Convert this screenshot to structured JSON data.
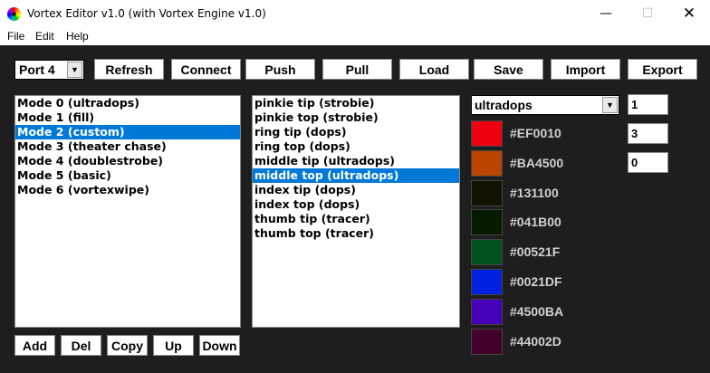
{
  "window": {
    "title": "Vortex Editor v1.0 (with Vortex Engine v1.0)",
    "controls": [
      "—",
      "☐",
      "✕"
    ]
  },
  "menu": [
    "File",
    "Edit",
    "Help"
  ],
  "port": {
    "selected": "Port 4"
  },
  "toolbar": [
    "Refresh",
    "Connect",
    "Push",
    "Pull",
    "Load",
    "Save",
    "Import",
    "Export"
  ],
  "modes": {
    "items": [
      "Mode 0 (ultradops)",
      "Mode 1 (fill)",
      "Mode 2 (custom)",
      "Mode 3 (theater chase)",
      "Mode 4 (doublestrobe)",
      "Mode 5 (basic)",
      "Mode 6 (vortexwipe)"
    ],
    "selected_index": 2
  },
  "leds": {
    "items": [
      "pinkie tip (strobie)",
      "pinkie top (strobie)",
      "ring tip (dops)",
      "ring top (dops)",
      "middle tip (ultradops)",
      "middle top (ultradops)",
      "index tip (dops)",
      "index top (dops)",
      "thumb tip (tracer)",
      "thumb top (tracer)"
    ],
    "selected_index": 5
  },
  "mode_buttons": [
    "Add",
    "Del",
    "Copy",
    "Up",
    "Down"
  ],
  "pattern": {
    "selected": "ultradops"
  },
  "params": [
    "1",
    "3",
    "0"
  ],
  "colors": [
    {
      "hex": "#EF0010",
      "swatch": "#EF0010"
    },
    {
      "hex": "#BA4500",
      "swatch": "#BA4500"
    },
    {
      "hex": "#131100",
      "swatch": "#131100"
    },
    {
      "hex": "#041B00",
      "swatch": "#041B00"
    },
    {
      "hex": "#00521F",
      "swatch": "#00521F"
    },
    {
      "hex": "#0021DF",
      "swatch": "#0021DF"
    },
    {
      "hex": "#4500BA",
      "swatch": "#4500BA"
    },
    {
      "hex": "#44002D",
      "swatch": "#44002D"
    }
  ]
}
